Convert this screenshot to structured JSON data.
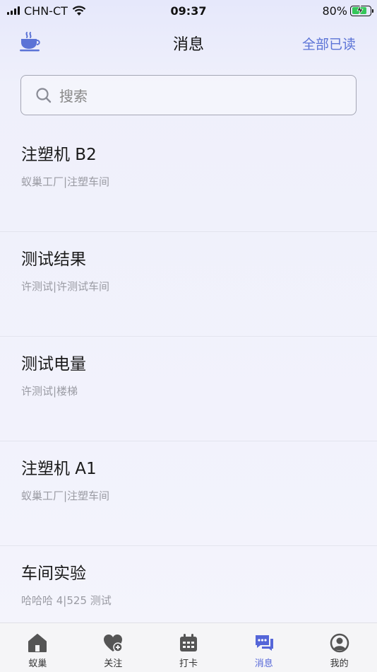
{
  "status_bar": {
    "carrier": "CHN-CT",
    "time": "09:37",
    "battery_percent": "80%",
    "battery_level": 0.8
  },
  "nav": {
    "title": "消息",
    "action_label": "全部已读",
    "logo_icon": "coffee-cup-icon"
  },
  "search": {
    "placeholder": "搜索"
  },
  "messages": [
    {
      "title": "注塑机 B2",
      "subtitle": "蚁巢工厂|注塑车间"
    },
    {
      "title": "测试结果",
      "subtitle": "许测试|许测试车间"
    },
    {
      "title": "测试电量",
      "subtitle": "许测试|楼梯"
    },
    {
      "title": "注塑机 A1",
      "subtitle": "蚁巢工厂|注塑车间"
    },
    {
      "title": "车间实验",
      "subtitle": "哈哈哈 4|525 测试"
    }
  ],
  "tabs": [
    {
      "label": "蚁巢",
      "icon": "home-icon",
      "active": false
    },
    {
      "label": "关注",
      "icon": "heart-plus-icon",
      "active": false
    },
    {
      "label": "打卡",
      "icon": "calendar-icon",
      "active": false
    },
    {
      "label": "消息",
      "icon": "chat-icon",
      "active": true
    },
    {
      "label": "我的",
      "icon": "user-icon",
      "active": false
    }
  ],
  "colors": {
    "accent": "#5b73d6",
    "tab_active": "#5566d8",
    "tab_inactive_icon": "#555555"
  }
}
